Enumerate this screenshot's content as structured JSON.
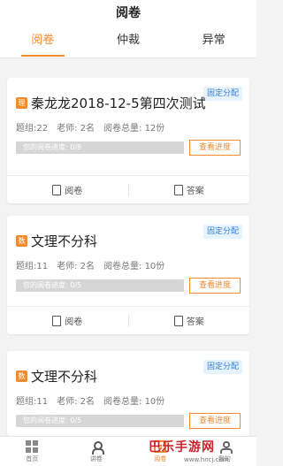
{
  "header": {
    "title": "阅卷"
  },
  "tabs": [
    {
      "label": "阅卷",
      "active": true
    },
    {
      "label": "仲裁",
      "active": false
    },
    {
      "label": "异常",
      "active": false
    }
  ],
  "cards": [
    {
      "tag": "固定分配",
      "subject_badge": "理",
      "title": "秦龙龙2018-12-5第四次测试",
      "meta": [
        "题组:22",
        "老师: 2名",
        "阅卷总量: 12份"
      ],
      "progress_label": "您的阅卷进度: 0/8",
      "progress": 0,
      "button_label": "查看进度",
      "actions": [
        "阅卷",
        "答案"
      ]
    },
    {
      "tag": "固定分配",
      "subject_badge": "数",
      "title": "文理不分科",
      "meta": [
        "题组:11",
        "老师: 2名",
        "阅卷总量: 10份"
      ],
      "progress_label": "您的阅卷进度: 0/5",
      "progress": 0,
      "button_label": "查看进度",
      "actions": [
        "阅卷",
        "答案"
      ]
    },
    {
      "tag": "固定分配",
      "subject_badge": "数",
      "title": "文理不分科",
      "meta": [
        "题组:11",
        "老师: 2名",
        "阅卷总量: 10份"
      ],
      "progress_label": "您的阅卷进度: 0/5",
      "progress": 0,
      "button_label": "查看进度"
    }
  ],
  "bottom_nav": [
    {
      "label": "首页",
      "icon": "grid-icon",
      "active": false
    },
    {
      "label": "讲卷",
      "icon": "person-board-icon",
      "active": false
    },
    {
      "label": "阅卷",
      "icon": "paper-icon",
      "active": true
    },
    {
      "label": "我的",
      "icon": "user-icon",
      "active": false
    }
  ],
  "watermark": {
    "text": "巴乐手游网",
    "url": "www.hncj.com"
  },
  "colors": {
    "accent": "#f28a2e",
    "tag_bg": "#e7f3ff",
    "tag_text": "#2f7fd6"
  }
}
